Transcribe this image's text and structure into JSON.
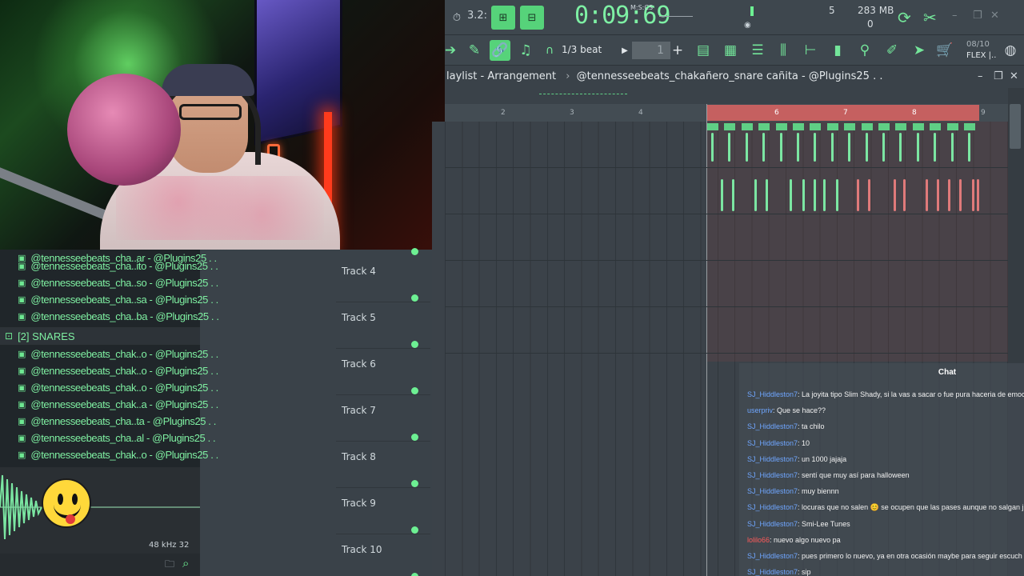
{
  "toolbar": {
    "time": "0:09:69",
    "time_unit": "M:S:CS",
    "tempo": "3.2:",
    "cpu_count": "5",
    "memory": "283 MB",
    "polyphony": "0",
    "snap": "1/3 beat",
    "pattern_number": "1",
    "version_info": "08/10",
    "flex_label": "FLEX |.."
  },
  "playlist": {
    "title": "laylist - Arrangement",
    "breadcrumb": "@tennesseebeats_chakañero_snare cañita - @Plugins25 . .",
    "ruler": [
      "2",
      "3",
      "4",
      "6",
      "7",
      "8",
      "9"
    ],
    "tracks": [
      {
        "name": "Track 4"
      },
      {
        "name": "Track 5"
      },
      {
        "name": "Track 6"
      },
      {
        "name": "Track 7"
      },
      {
        "name": "Track 8"
      },
      {
        "name": "Track 9"
      },
      {
        "name": "Track 10"
      }
    ]
  },
  "browser": {
    "items_top": [
      "@tennesseebeats_cha..ar - @Plugins25 . .",
      "@tennesseebeats_cha..ito - @Plugins25 . .",
      "@tennesseebeats_cha..so - @Plugins25 . .",
      "@tennesseebeats_cha..sa - @Plugins25 . .",
      "@tennesseebeats_cha..ba - @Plugins25 . ."
    ],
    "folder": "[2] SNARES",
    "items_snares": [
      "@tennesseebeats_chak..o - @Plugins25 . .",
      "@tennesseebeats_chak..o - @Plugins25 . .",
      "@tennesseebeats_chak..o - @Plugins25 . .",
      "@tennesseebeats_chak..a - @Plugins25 . .",
      "@tennesseebeats_cha..ta - @Plugins25 . .",
      "@tennesseebeats_cha..al - @Plugins25 . .",
      "@tennesseebeats_chak..o - @Plugins25 . ."
    ],
    "sample_rate": "48 kHz 32"
  },
  "chat": {
    "title": "Chat",
    "messages": [
      {
        "user": "SJ_Hiddleston7",
        "text": ": La joyita tipo Slim Shady, si la vas a sacar o fue pura haceria de emoc",
        "red": false
      },
      {
        "user": "userpriv",
        "text": ": Que se hace??",
        "red": false
      },
      {
        "user": "SJ_Hiddleston7",
        "text": ": ta chilo",
        "red": false
      },
      {
        "user": "SJ_Hiddleston7",
        "text": ": 10",
        "red": false
      },
      {
        "user": "SJ_Hiddleston7",
        "text": ": un 1000 jajaja",
        "red": false
      },
      {
        "user": "SJ_Hiddleston7",
        "text": ": sentí que muy así para halloween",
        "red": false
      },
      {
        "user": "SJ_Hiddleston7",
        "text": ": muy biennn",
        "red": false
      },
      {
        "user": "SJ_Hiddleston7",
        "text": ": locuras que no salen 😊 se ocupen que las pases aunque no salgan j",
        "red": false
      },
      {
        "user": "SJ_Hiddleston7",
        "text": ": Smi-Lee Tunes",
        "red": false
      },
      {
        "user": "lolilo66",
        "text": ": nuevo algo nuevo pa",
        "red": true
      },
      {
        "user": "SJ_Hiddleston7",
        "text": ": pues primero lo nuevo, ya en otra ocasión maybe para seguir escuch",
        "red": false
      },
      {
        "user": "SJ_Hiddleston7",
        "text": ": sip",
        "red": false
      }
    ]
  },
  "colors": {
    "accent_green": "#56d37a",
    "clip_red": "#e07a7a",
    "selection_red": "#c56060",
    "chat_user": "#6fa6ff"
  }
}
